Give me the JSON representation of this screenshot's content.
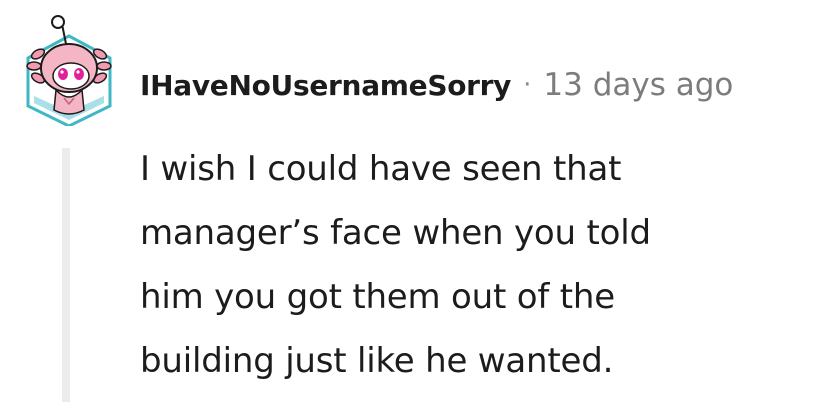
{
  "comment": {
    "author": "IHaveNoUsernameSorry",
    "separator": "·",
    "timestamp": "13 days ago",
    "body_lines": [
      "I wish I could have seen that",
      "manager’s face when you told",
      "him you got them out of the",
      "building just like he wanted."
    ],
    "avatar_icon": "axolotl-snoo-avatar-icon"
  },
  "colors": {
    "text": "#1c1c1c",
    "muted": "#7c7c7c",
    "thread_line": "#ececec",
    "avatar_pink": "#f2a9b8",
    "avatar_frame": "#4bc0c8"
  }
}
